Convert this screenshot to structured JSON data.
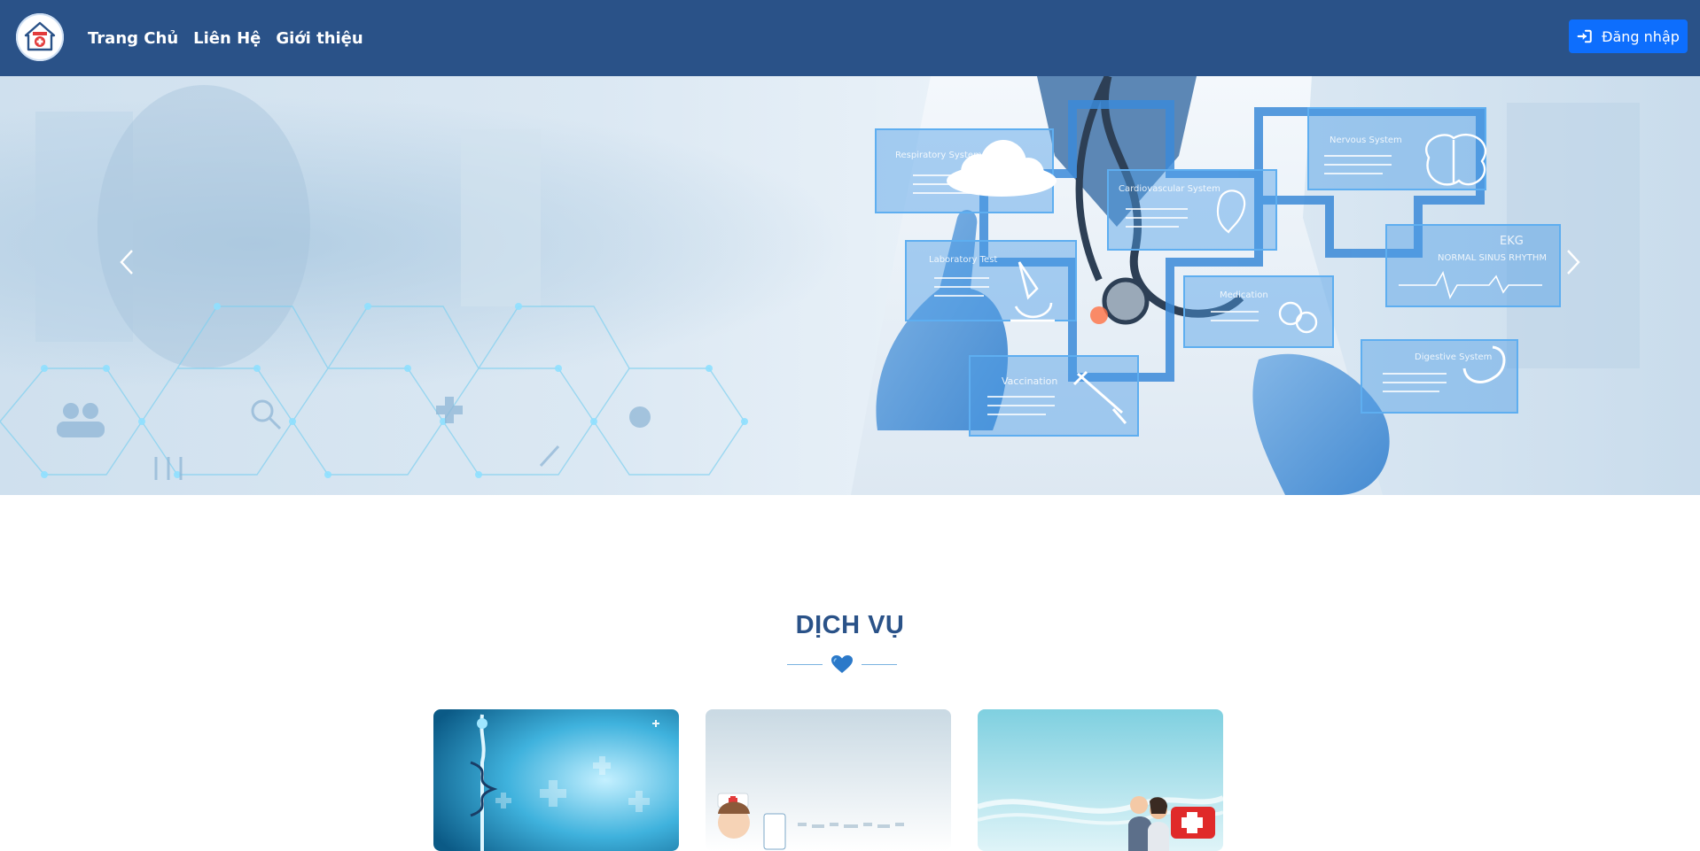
{
  "header": {
    "logo_icon": "hospital-home-logo",
    "nav": [
      {
        "label": "Trang Chủ"
      },
      {
        "label": "Liên Hệ"
      },
      {
        "label": "Giới thiệu"
      }
    ],
    "login": {
      "label": "Đăng nhập",
      "icon": "sign-in-icon"
    },
    "colors": {
      "navbar": "#2a5288",
      "login_button": "#0d6efd"
    }
  },
  "hero": {
    "panels": [
      {
        "label": "Respiratory System"
      },
      {
        "label": "Cardiovascular System"
      },
      {
        "label": "Nervous System"
      },
      {
        "label": "Laboratory Test"
      },
      {
        "label": "Medication"
      },
      {
        "label": "EKG"
      },
      {
        "label": "NORMAL SINUS RHYTHM"
      },
      {
        "label": "Vaccination"
      },
      {
        "label": "Digestive System"
      }
    ],
    "controls": {
      "prev_icon": "chevron-left-icon",
      "next_icon": "chevron-right-icon"
    }
  },
  "services": {
    "title": "DỊCH VỤ",
    "divider_icon": "blue-heart-icon",
    "accent": "#2a5288",
    "cards": [
      {
        "name": "medical-caduceus-card"
      },
      {
        "name": "nurse-card"
      },
      {
        "name": "doctors-firstaid-card"
      }
    ]
  }
}
